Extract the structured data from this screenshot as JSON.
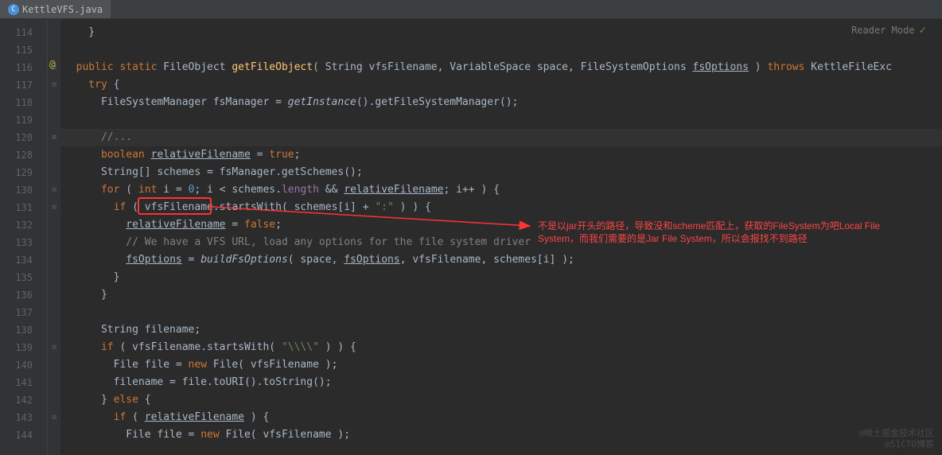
{
  "tab": {
    "filename": "KettleVFS.java",
    "icon_label": "C"
  },
  "reader_mode_label": "Reader Mode",
  "line_numbers": [
    "114",
    "115",
    "116",
    "117",
    "118",
    "119",
    "120",
    "128",
    "129",
    "130",
    "131",
    "132",
    "133",
    "134",
    "135",
    "136",
    "137",
    "138",
    "139",
    "140",
    "141",
    "142",
    "143",
    "144"
  ],
  "annotation_at": "@",
  "code": {
    "l114": "    }",
    "l115": "",
    "l116_pre": "  ",
    "l116_public": "public",
    "l116_static": " static",
    "l116_type": " FileObject ",
    "l116_method": "getFileObject",
    "l116_sig1": "( String vfsFilename, VariableSpace space, FileSystemOptions ",
    "l116_fsopt": "fsOptions",
    "l116_sig2": " ) ",
    "l116_throws": "throws",
    "l116_exc": " KettleFileExc",
    "l117_try": "    try",
    "l117_brace": " {",
    "l118": "      FileSystemManager fsManager = ",
    "l118_gi": "getInstance",
    "l118_b": "().getFileSystemManager();",
    "l119": "",
    "l120_pre": "      ",
    "l120_comment": "//...",
    "l128_pre": "      ",
    "l128_bool": "boolean",
    "l128_mid": " ",
    "l128_var": "relativeFilename",
    "l128_eq": " = ",
    "l128_true": "true",
    "l128_semi": ";",
    "l129": "      String[] schemes = fsManager.getSchemes();",
    "l130_pre": "      ",
    "l130_for": "for",
    "l130_a": " ( ",
    "l130_int": "int",
    "l130_b": " i = ",
    "l130_zero": "0",
    "l130_c": "; i < schemes.",
    "l130_len": "length",
    "l130_d": " && ",
    "l130_rf": "relativeFilename",
    "l130_e": "; i++ ) {",
    "l131_pre": "        ",
    "l131_if": "if",
    "l131_a": " ( ",
    "l131_vfs": "vfsFilename",
    "l131_b": ".startsWith( schemes[i] + ",
    "l131_colon": "\":\"",
    "l131_c": " ) ) {",
    "l132_pre": "          ",
    "l132_rf": "relativeFilename",
    "l132_eq": " = ",
    "l132_false": "false",
    "l132_semi": ";",
    "l133_pre": "          ",
    "l133_comment": "// We have a VFS URL, load any options for the file system driver",
    "l134_pre": "          ",
    "l134_fs": "fsOptions",
    "l134_eq": " = ",
    "l134_build": "buildFsOptions",
    "l134_a": "( space, ",
    "l134_fs2": "fsOptions",
    "l134_b": ", vfsFilename, schemes[i] );",
    "l135": "        }",
    "l136": "      }",
    "l137": "",
    "l138": "      String filename;",
    "l139_pre": "      ",
    "l139_if": "if",
    "l139_a": " ( vfsFilename.startsWith( ",
    "l139_str": "\"\\\\\\\\\"",
    "l139_b": " ) ) {",
    "l140_pre": "        File file = ",
    "l140_new": "new",
    "l140_b": " File( vfsFilename );",
    "l141": "        filename = file.toURI().toString();",
    "l142_pre": "      } ",
    "l142_else": "else",
    "l142_b": " {",
    "l143_pre": "        ",
    "l143_if": "if",
    "l143_a": " ( ",
    "l143_rf": "relativeFilename",
    "l143_b": " ) {",
    "l144_pre": "          File file = ",
    "l144_new": "new",
    "l144_b": " File( vfsFilename );"
  },
  "annotation": {
    "line1": "不是以jar开头的路径，导致没和scheme匹配上，获取的FileSystem为吧Local File",
    "line2": "System，而我们需要的是Jar File System，所以会报找不到路径"
  },
  "watermark": {
    "line1": "@稀土掘金技术社区",
    "line2": "@51CTO博客"
  }
}
